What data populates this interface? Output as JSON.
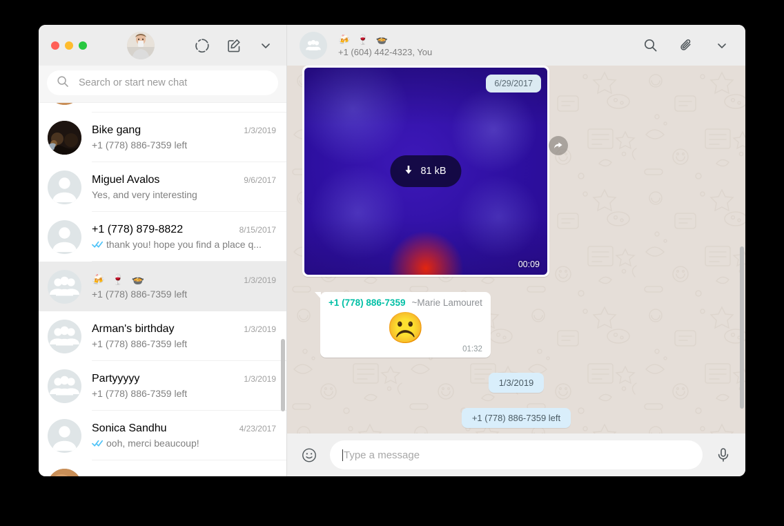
{
  "app": {
    "title": "WhatsApp Desktop"
  },
  "sidebar": {
    "header": {
      "avatar_icon": "user-photo-avatar",
      "status_icon": "status-ring-icon",
      "new_chat_icon": "new-chat-compose-icon",
      "menu_icon": "chevron-down-icon"
    },
    "search": {
      "icon": "search-icon",
      "placeholder": "Search or start new chat",
      "value": ""
    },
    "chats": [
      {
        "title": "",
        "preview": "",
        "time": "",
        "avatar": "photo-warm",
        "selected": false,
        "partial_top": true,
        "ticks": false
      },
      {
        "title": "Bike gang",
        "preview": "+1 (778) 886-7359 left",
        "time": "1/3/2019",
        "avatar": "photo-dark",
        "selected": false,
        "ticks": false
      },
      {
        "title": "Miguel Avalos",
        "preview": "Yes, and very interesting",
        "time": "9/6/2017",
        "avatar": "person",
        "selected": false,
        "ticks": false
      },
      {
        "title": "+1 (778) 879-8822",
        "preview": "thank you! hope you find a place q...",
        "time": "8/15/2017",
        "avatar": "person",
        "selected": false,
        "ticks": true
      },
      {
        "title": "🍻 🍷 🍲",
        "preview": "+1 (778) 886-7359 left",
        "time": "1/3/2019",
        "avatar": "group",
        "selected": true,
        "is_emoji_title": true,
        "ticks": false
      },
      {
        "title": "Arman's birthday",
        "preview": "+1 (778) 886-7359 left",
        "time": "1/3/2019",
        "avatar": "group",
        "selected": false,
        "ticks": false
      },
      {
        "title": "Partyyyyy",
        "preview": "+1 (778) 886-7359 left",
        "time": "1/3/2019",
        "avatar": "group",
        "selected": false,
        "ticks": false
      },
      {
        "title": "Sonica Sandhu",
        "preview": "ooh, merci beaucoup!",
        "time": "4/23/2017",
        "avatar": "person",
        "selected": false,
        "ticks": true
      },
      {
        "title": "",
        "preview": "",
        "time": "",
        "avatar": "photo-warm",
        "selected": false,
        "partial_bottom": true,
        "ticks": false
      }
    ]
  },
  "chat": {
    "header": {
      "avatar_icon": "group-avatar-icon",
      "title": "🍻 🍷 🍲",
      "participants": "+1 (604) 442-4323, You",
      "search_icon": "search-icon",
      "attach_icon": "paperclip-icon",
      "menu_icon": "chevron-down-icon"
    },
    "messages": [
      {
        "type": "video",
        "date_chip": "6/29/2017",
        "download_label": "81 kB",
        "download_icon": "download-arrow-icon",
        "duration": "00:09",
        "forward_icon": "forward-arrow-icon"
      },
      {
        "type": "incoming-emoji",
        "sender": "+1 (778) 886-7359",
        "alias": "~Marie Lamouret",
        "emoji": "☹️",
        "time": "01:32"
      },
      {
        "type": "system",
        "text": "1/3/2019"
      },
      {
        "type": "system",
        "text": "+1 (778) 886-7359 left"
      }
    ],
    "footer": {
      "emoji_icon": "smiley-emoji-icon",
      "placeholder": "Type a message",
      "value": "",
      "mic_icon": "microphone-icon"
    }
  },
  "colors": {
    "accent_green": "#00bfa5",
    "header_gray": "#ededed",
    "chat_bg": "#e5ded8",
    "system_chip": "#d9eefb",
    "tick_blue": "#4fc3f7",
    "selected_row": "#ebebeb"
  }
}
